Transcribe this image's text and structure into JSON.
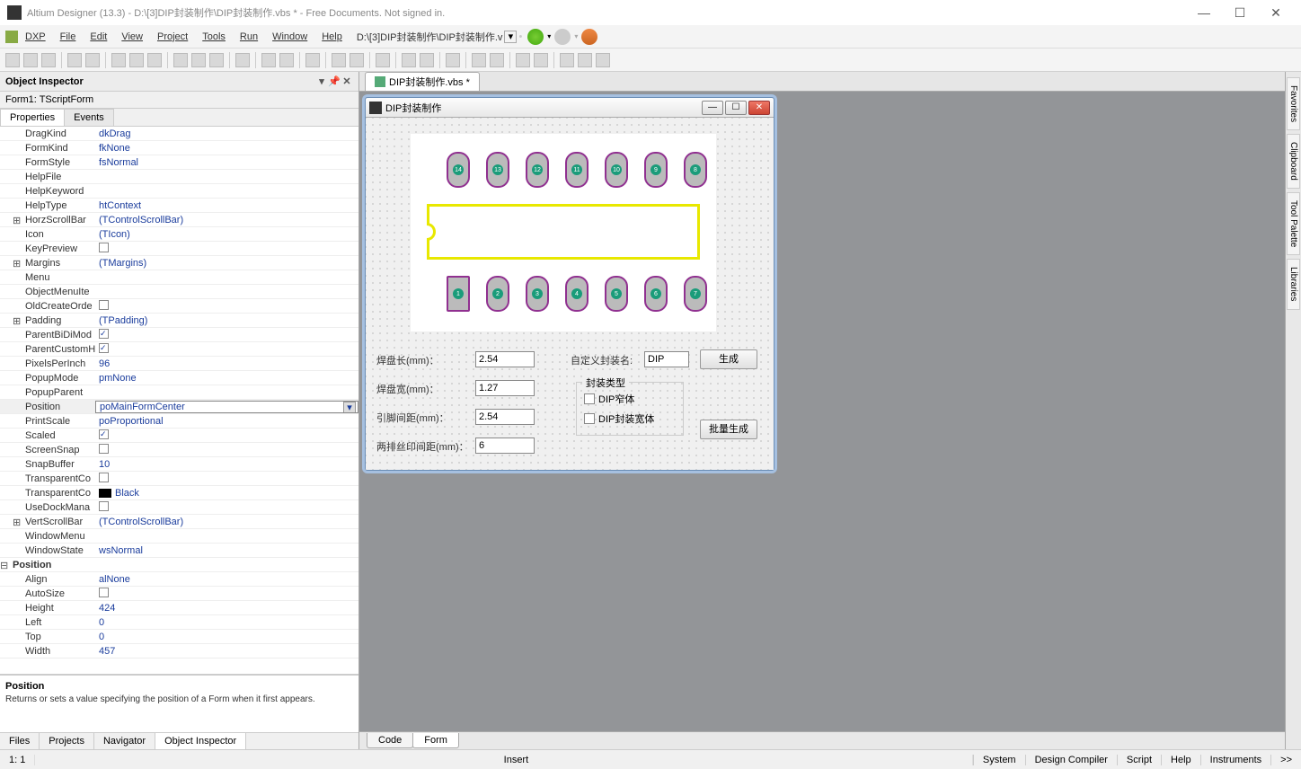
{
  "window": {
    "title": "Altium Designer (13.3) - D:\\[3]DIP封装制作\\DIP封装制作.vbs * - Free Documents. Not signed in."
  },
  "menu": {
    "dxp": "DXP",
    "file": "File",
    "edit": "Edit",
    "view": "View",
    "project": "Project",
    "tools": "Tools",
    "run": "Run",
    "window": "Window",
    "help": "Help",
    "path": "D:\\[3]DIP封装制作\\DIP封装制作.v"
  },
  "inspector": {
    "title": "Object Inspector",
    "form_name": "Form1: TScriptForm",
    "tab_properties": "Properties",
    "tab_events": "Events",
    "desc_title": "Position",
    "desc_body": "Returns or sets a value specifying the position of a Form when it first appears."
  },
  "properties": [
    {
      "name": "DragKind",
      "value": "dkDrag",
      "type": "text"
    },
    {
      "name": "FormKind",
      "value": "fkNone",
      "type": "text"
    },
    {
      "name": "FormStyle",
      "value": "fsNormal",
      "type": "text"
    },
    {
      "name": "HelpFile",
      "value": "",
      "type": "text"
    },
    {
      "name": "HelpKeyword",
      "value": "",
      "type": "text"
    },
    {
      "name": "HelpType",
      "value": "htContext",
      "type": "text"
    },
    {
      "name": "HorzScrollBar",
      "value": "(TControlScrollBar)",
      "type": "expandable"
    },
    {
      "name": "Icon",
      "value": "(TIcon)",
      "type": "text"
    },
    {
      "name": "KeyPreview",
      "value": "",
      "type": "check",
      "checked": false
    },
    {
      "name": "Margins",
      "value": "(TMargins)",
      "type": "expandable"
    },
    {
      "name": "Menu",
      "value": "",
      "type": "text"
    },
    {
      "name": "ObjectMenuIte",
      "value": "",
      "type": "text"
    },
    {
      "name": "OldCreateOrde",
      "value": "",
      "type": "check",
      "checked": false
    },
    {
      "name": "Padding",
      "value": "(TPadding)",
      "type": "expandable"
    },
    {
      "name": "ParentBiDiMod",
      "value": "",
      "type": "check",
      "checked": true
    },
    {
      "name": "ParentCustomH",
      "value": "",
      "type": "check",
      "checked": true
    },
    {
      "name": "PixelsPerInch",
      "value": "96",
      "type": "text"
    },
    {
      "name": "PopupMode",
      "value": "pmNone",
      "type": "text"
    },
    {
      "name": "PopupParent",
      "value": "",
      "type": "text"
    },
    {
      "name": "Position",
      "value": "poMainFormCenter",
      "type": "dropdown",
      "selected": true
    },
    {
      "name": "PrintScale",
      "value": "poProportional",
      "type": "text"
    },
    {
      "name": "Scaled",
      "value": "",
      "type": "check",
      "checked": true
    },
    {
      "name": "ScreenSnap",
      "value": "",
      "type": "check",
      "checked": false
    },
    {
      "name": "SnapBuffer",
      "value": "10",
      "type": "text"
    },
    {
      "name": "TransparentCo",
      "value": "",
      "type": "check",
      "checked": false
    },
    {
      "name": "TransparentCo",
      "value": "Black",
      "type": "color"
    },
    {
      "name": "UseDockMana",
      "value": "",
      "type": "check",
      "checked": false
    },
    {
      "name": "VertScrollBar",
      "value": "(TControlScrollBar)",
      "type": "expandable"
    },
    {
      "name": "WindowMenu",
      "value": "",
      "type": "text"
    },
    {
      "name": "WindowState",
      "value": "wsNormal",
      "type": "text"
    }
  ],
  "position_group": {
    "label": "Position",
    "items": [
      {
        "name": "Align",
        "value": "alNone",
        "type": "text"
      },
      {
        "name": "AutoSize",
        "value": "",
        "type": "check",
        "checked": false
      },
      {
        "name": "Height",
        "value": "424",
        "type": "text"
      },
      {
        "name": "Left",
        "value": "0",
        "type": "text"
      },
      {
        "name": "Top",
        "value": "0",
        "type": "text"
      },
      {
        "name": "Width",
        "value": "457",
        "type": "text"
      }
    ]
  },
  "bottom_tabs": {
    "files": "Files",
    "projects": "Projects",
    "navigator": "Navigator",
    "object_inspector": "Object Inspector"
  },
  "document": {
    "tab": "DIP封装制作.vbs *",
    "code_tab": "Code",
    "form_tab": "Form"
  },
  "dip_form": {
    "title": "DIP封装制作",
    "pads_top": [
      "14",
      "13",
      "12",
      "11",
      "10",
      "9",
      "8"
    ],
    "pads_bottom": [
      "1",
      "2",
      "3",
      "4",
      "5",
      "6",
      "7"
    ],
    "label_length": "焊盘长(mm)：",
    "label_width": "焊盘宽(mm)：",
    "label_pitch": "引脚间距(mm)：",
    "label_silk": "两排丝印间距(mm)：",
    "label_custom": "自定义封装名:",
    "val_length": "2.54",
    "val_width": "1.27",
    "val_pitch": "2.54",
    "val_silk": "6",
    "val_custom": "DIP",
    "btn_generate": "生成",
    "group_type": "封装类型",
    "chk_narrow": "DIP窄体",
    "chk_wide": "DIP封装宽体",
    "btn_batch": "批量生成"
  },
  "right_tabs": {
    "favorites": "Favorites",
    "clipboard": "Clipboard",
    "tool_palette": "Tool Palette",
    "libraries": "Libraries"
  },
  "status": {
    "coord": "1: 1",
    "mode": "Insert",
    "system": "System",
    "design_compiler": "Design Compiler",
    "script": "Script",
    "help": "Help",
    "instruments": "Instruments",
    "more": ">>"
  }
}
